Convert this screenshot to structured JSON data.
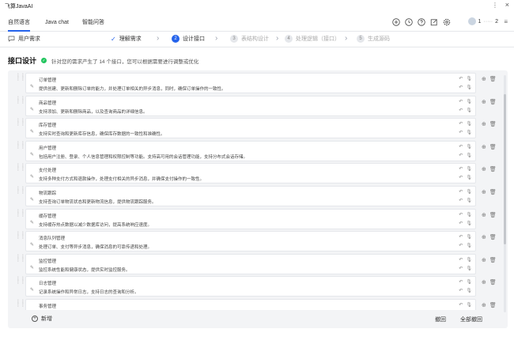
{
  "app": {
    "title": "飞算JavaAI"
  },
  "nav": {
    "tabs": [
      "自然语言",
      "Java chat",
      "智能问答"
    ],
    "icons": [
      "plus-circle-icon",
      "history-icon",
      "help-icon",
      "edit-icon",
      "settings-icon"
    ],
    "user": "1",
    "user_tail": "2"
  },
  "steps": {
    "requirement": "用户需求",
    "items": [
      {
        "num": "✓",
        "label": "理解需求",
        "state": "done"
      },
      {
        "num": "2",
        "label": "设计接口",
        "state": "active"
      },
      {
        "num": "3",
        "label": "表结构设计",
        "state": "pending"
      },
      {
        "num": "4",
        "label": "处理逻辑（接口）",
        "state": "pending"
      },
      {
        "num": "5",
        "label": "生成源码",
        "state": "pending"
      }
    ]
  },
  "header": {
    "title": "接口设计",
    "message": "针对您的需求产生了 14 个接口，您可以根据需要进行调整或优化"
  },
  "interfaces": [
    {
      "name": "订单管理",
      "desc": "提供创建、更新和删除订单的能力，并处理订单相关的异步消息，同时，确保订单操作的一致性。"
    },
    {
      "name": "商品管理",
      "desc": "支持添加、更新和删除商品，以及查询商品的详细信息。"
    },
    {
      "name": "库存管理",
      "desc": "支持实时查询和更新库存信息，确保库存数据的一致性和准确性。"
    },
    {
      "name": "用户管理",
      "desc": "包括用户注册、登录、个人信息管理和权限控制等功能。支持高可用的会话管理功能，支持分布式会话存储。"
    },
    {
      "name": "支付处理",
      "desc": "支持多种支付方式和退款操作，处理支付相关的异步消息，并确保支付操作的一致性。"
    },
    {
      "name": "物流跟踪",
      "desc": "支持查询订单物流状态和更新物流信息，提供物流跟踪服务。"
    },
    {
      "name": "缓存管理",
      "desc": "支持缓存热点数据以减少数据库访问，提高系统响应速度。"
    },
    {
      "name": "消息队列管理",
      "desc": "处理订单、支付等异步消息，确保消息的可靠传递和处理。"
    },
    {
      "name": "监控管理",
      "desc": "监控系统性能和健康状态，提供实时监控服务。"
    },
    {
      "name": "日志管理",
      "desc": "记录系统操作和异常日志，支持日志的查询和分析。"
    },
    {
      "name": "事务管理",
      "desc": ""
    }
  ],
  "footer": {
    "add_label": "新增",
    "undo_label": "撤回",
    "undo_all_label": "全部撤回"
  },
  "colors": {
    "accent": "#2563eb",
    "success": "#22c55e"
  }
}
